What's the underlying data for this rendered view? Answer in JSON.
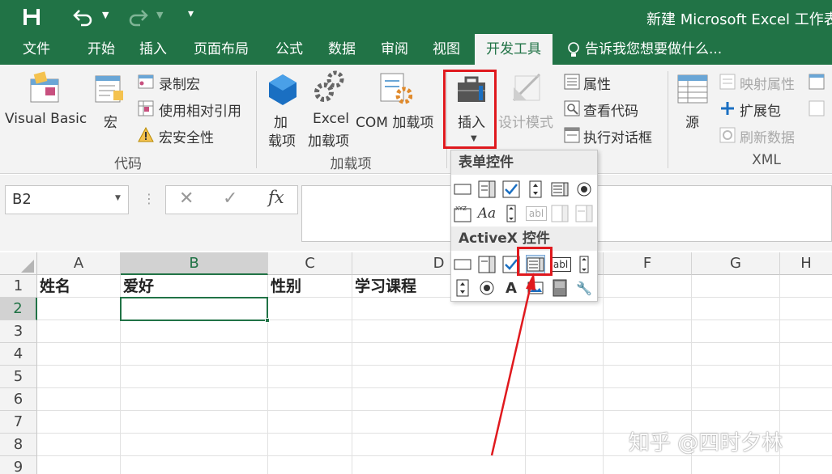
{
  "window": {
    "title": "新建 Microsoft Excel 工作表"
  },
  "qat": {
    "save_icon": "save-icon",
    "undo_icon": "undo-icon",
    "redo_icon": "redo-icon",
    "customize_icon": "customize-qat-icon"
  },
  "tabs": [
    "文件",
    "开始",
    "插入",
    "页面布局",
    "公式",
    "数据",
    "审阅",
    "视图",
    "开发工具"
  ],
  "active_tab": "开发工具",
  "tell_me": "告诉我您想要做什么...",
  "ribbon": {
    "code": {
      "label": "代码",
      "visual_basic": "Visual Basic",
      "macros": "宏",
      "record_macro": "录制宏",
      "relative_refs": "使用相对引用",
      "macro_security": "宏安全性"
    },
    "addins": {
      "label": "加载项",
      "addins_line1": "加",
      "addins_line2": "载项",
      "excel_addins_line1": "Excel",
      "excel_addins_line2": "加载项",
      "com_addins": "COM 加载项"
    },
    "controls": {
      "insert": "插入",
      "design_mode": "设计模式",
      "properties": "属性",
      "view_code": "查看代码",
      "run_dialog": "执行对话框"
    },
    "xml": {
      "label": "XML",
      "source": "源",
      "map_properties": "映射属性",
      "expansion_packs": "扩展包",
      "refresh_data": "刷新数据"
    }
  },
  "formula_bar": {
    "name_box": "B2",
    "cancel": "✕",
    "enter": "✓",
    "fx": "fx",
    "content": ""
  },
  "columns": [
    "A",
    "B",
    "C",
    "D",
    "E",
    "F",
    "G",
    "H"
  ],
  "selected_column": "B",
  "rows": [
    "1",
    "2",
    "3",
    "4",
    "5",
    "6",
    "7",
    "8",
    "9"
  ],
  "selected_row": "2",
  "cells": {
    "A1": "姓名",
    "B1": "爱好",
    "C1": "性别",
    "D1": "学习课程"
  },
  "dropdown": {
    "form_controls_header": "表单控件",
    "activex_header": "ActiveX 控件",
    "form_controls": [
      "button-control-icon",
      "combo-box-icon",
      "check-box-icon",
      "spin-button-icon",
      "list-box-icon",
      "option-button-icon",
      "group-box-icon",
      "label-icon",
      "scroll-bar-icon",
      "text-field-icon",
      "combo-list-edit-icon",
      "combo-drop-edit-icon"
    ],
    "activex_controls": [
      "command-button-icon",
      "combo-box-icon",
      "check-box-icon",
      "list-box-icon",
      "text-box-icon",
      "scroll-bar-icon",
      "spin-button-icon",
      "option-button-icon",
      "label-icon",
      "image-icon",
      "toggle-button-icon",
      "more-controls-icon"
    ],
    "xyz_label": "XYZ",
    "aa_label": "Aa",
    "abl_label": "abl",
    "a_label": "A"
  },
  "watermark": "知乎 @四时夕林",
  "colors": {
    "excel_green": "#217346",
    "highlight_red": "#e0191e",
    "ribbon_bg": "#f3f3f3"
  }
}
